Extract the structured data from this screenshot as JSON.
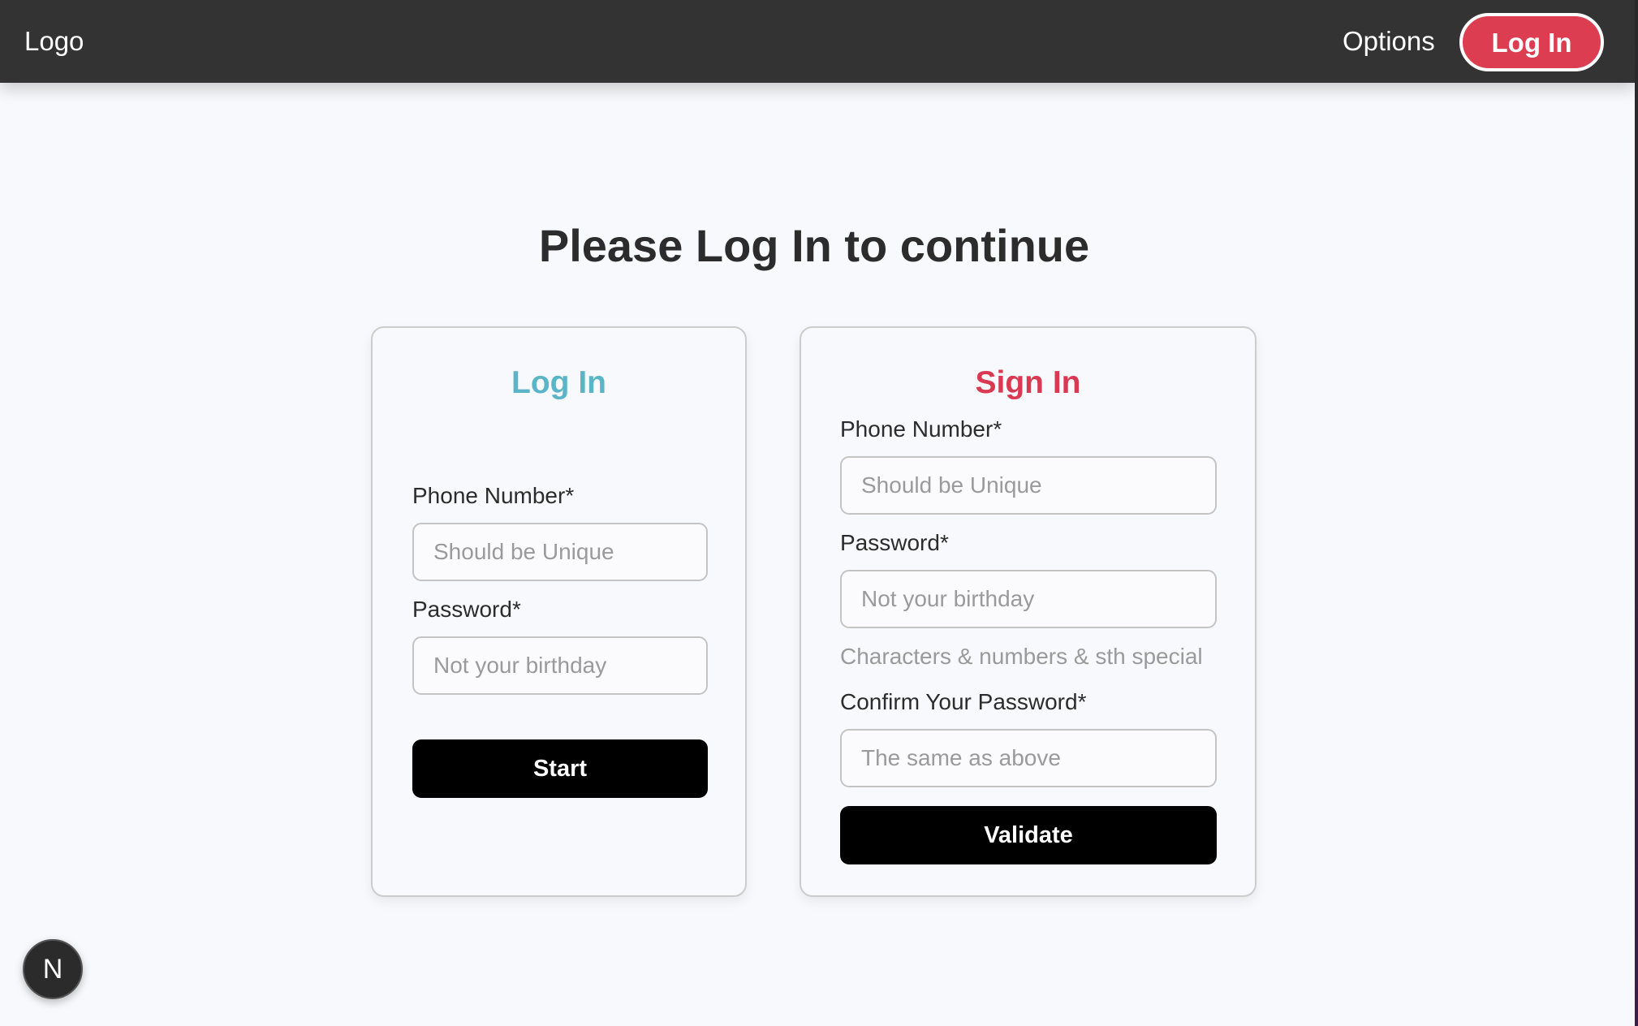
{
  "navbar": {
    "logo_text": "Logo",
    "options_label": "Options",
    "login_button_label": "Log In",
    "login_button_color": "#dc3d50",
    "background_color": "#333333"
  },
  "page": {
    "title": "Please Log In to continue"
  },
  "login_card": {
    "title": "Log In",
    "title_color": "#5ab5c8",
    "phone_label": "Phone Number*",
    "phone_placeholder": "Should be Unique",
    "phone_value": "",
    "password_label": "Password*",
    "password_placeholder": "Not your birthday",
    "password_value": "",
    "submit_label": "Start"
  },
  "signin_card": {
    "title": "Sign In",
    "title_color": "#d93a52",
    "phone_label": "Phone Number*",
    "phone_placeholder": "Should be Unique",
    "phone_value": "",
    "password_label": "Password*",
    "password_placeholder": "Not your birthday",
    "password_value": "",
    "password_hint": "Characters & numbers & sth special",
    "confirm_label": "Confirm Your Password*",
    "confirm_placeholder": "The same as above",
    "confirm_value": "",
    "submit_label": "Validate"
  },
  "dev_badge": {
    "label": "N"
  }
}
